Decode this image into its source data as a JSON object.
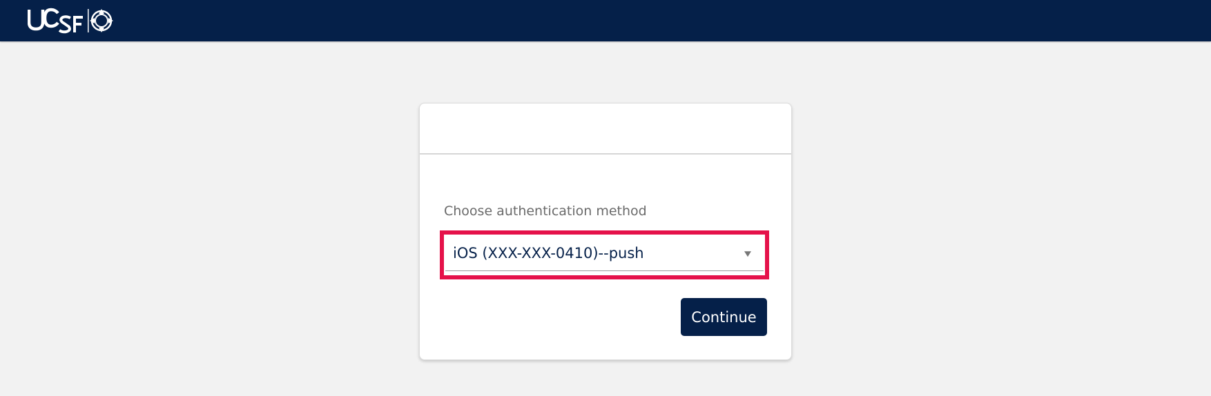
{
  "header": {
    "logo_text": "UCSF",
    "logo_icon": "compass-seal-icon",
    "background_color": "#052049"
  },
  "auth_card": {
    "label": "Choose authentication method",
    "selected_method": "iOS (XXX-XXX-0410)--push",
    "dropdown_icon": "chevron-down-icon",
    "highlight_color": "#e5124a",
    "continue_label": "Continue",
    "button_color": "#052049"
  }
}
